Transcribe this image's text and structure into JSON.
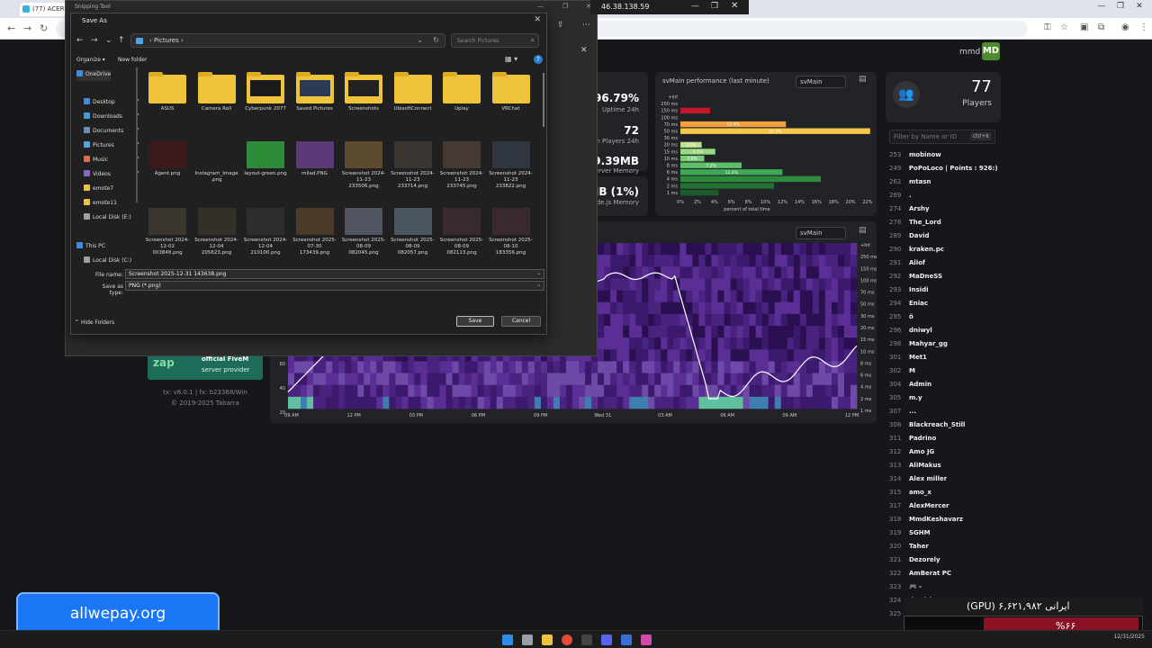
{
  "browser": {
    "tab_title": "(77) ACER?",
    "window_controls": [
      "—",
      "❐",
      "✕"
    ],
    "nav": [
      "←",
      "→",
      "↻"
    ]
  },
  "txadmin": {
    "user": "mmd",
    "avatar": "MD",
    "players": {
      "count": "77",
      "label": "Players"
    },
    "filter_placeholder": "Filter by Name or ID",
    "filter_kbd": "ctrl+k",
    "stats_right": [
      {
        "big": "96.79%",
        "small": "Uptime 24h"
      },
      {
        "big": "72",
        "small": "an Players 24h"
      },
      {
        "big": "929.39MB",
        "small": "erver Memory"
      },
      {
        "big": "1MB (1%)",
        "small": "de.js Memory"
      }
    ],
    "perf": {
      "title": "svMain performance (last minute)",
      "select": "svMain",
      "xlabel": "percent of total time"
    },
    "heat_select": "svMain",
    "sponsor": {
      "logo": "zap",
      "line1": "official FiveM",
      "line2": "server provider"
    },
    "version": [
      "tx: v8.0.1 | fx: b23368/Win",
      "© 2019-2025 Tabarra"
    ],
    "player_list": [
      {
        "id": "253",
        "name": "mobinow"
      },
      {
        "id": "249",
        "name": "PoPoLoco | Points : 926:)"
      },
      {
        "id": "262",
        "name": "mtasn"
      },
      {
        "id": "269",
        "name": "."
      },
      {
        "id": "274",
        "name": "Arshy"
      },
      {
        "id": "278",
        "name": "The_Lord"
      },
      {
        "id": "289",
        "name": "David"
      },
      {
        "id": "290",
        "name": "kraken.pc"
      },
      {
        "id": "291",
        "name": "Aliof"
      },
      {
        "id": "292",
        "name": "MaDneSS"
      },
      {
        "id": "293",
        "name": "Insidi"
      },
      {
        "id": "294",
        "name": "Eniac"
      },
      {
        "id": "295",
        "name": "ö"
      },
      {
        "id": "296",
        "name": "dniwyl"
      },
      {
        "id": "298",
        "name": "Mahyar_gg"
      },
      {
        "id": "301",
        "name": "Met1"
      },
      {
        "id": "302",
        "name": "M"
      },
      {
        "id": "304",
        "name": "Admin"
      },
      {
        "id": "305",
        "name": "m.y"
      },
      {
        "id": "307",
        "name": "..."
      },
      {
        "id": "308",
        "name": "Blackreach_Still"
      },
      {
        "id": "311",
        "name": "Padrino"
      },
      {
        "id": "312",
        "name": "Amo JG"
      },
      {
        "id": "313",
        "name": "AliMakus"
      },
      {
        "id": "314",
        "name": "Alex miller"
      },
      {
        "id": "315",
        "name": "amo_x"
      },
      {
        "id": "317",
        "name": "AlexMercer"
      },
      {
        "id": "318",
        "name": "MmdKeshavarz"
      },
      {
        "id": "319",
        "name": "SGHM"
      },
      {
        "id": "320",
        "name": "Taher"
      },
      {
        "id": "321",
        "name": "Dezorely"
      },
      {
        "id": "322",
        "name": "AmBerat PC"
      },
      {
        "id": "323",
        "name": "🎮 -"
      },
      {
        "id": "324",
        "name": "Ilyad_krm"
      },
      {
        "id": "325",
        "name": "?"
      }
    ]
  },
  "perf_chart": {
    "type": "bar",
    "categories": [
      "+Inf",
      "250 ms",
      "150 ms",
      "100 ms",
      "70 ms",
      "50 ms",
      "30 ms",
      "20 ms",
      "15 ms",
      "10 ms",
      "8 ms",
      "6 ms",
      "4 ms",
      "2 ms",
      "1 ms"
    ],
    "values": [
      0,
      0,
      3.5,
      0,
      12.4,
      22.3,
      0,
      2.5,
      4.1,
      2.8,
      7.2,
      12.0,
      16.5,
      11.0,
      4.5
    ],
    "data_labels": [
      "",
      "",
      "",
      "",
      "12.4%",
      "22.3%",
      "",
      "2.5%",
      "4.1%",
      "2.8%",
      "7.2%",
      "12.0%",
      "",
      "",
      ""
    ],
    "xticks": [
      "0%",
      "2%",
      "4%",
      "6%",
      "8%",
      "10%",
      "12%",
      "14%",
      "16%",
      "18%",
      "20%",
      "22%"
    ],
    "xlim": [
      0,
      22
    ],
    "xlabel": "percent of total time"
  },
  "heat_chart": {
    "type": "heatmap",
    "x_ticks": [
      "09 AM",
      "12 PM",
      "03 PM",
      "06 PM",
      "09 PM",
      "Wed 31",
      "03 AM",
      "06 AM",
      "09 AM",
      "12 PM"
    ],
    "y_ticks": [
      "+Inf",
      "250 ms",
      "150 ms",
      "100 ms",
      "70 ms",
      "50 ms",
      "30 ms",
      "20 ms",
      "15 ms",
      "10 ms",
      "8 ms",
      "6 ms",
      "4 ms",
      "2 ms",
      "1 ms"
    ],
    "y_left": [
      "60",
      "40",
      "20"
    ]
  },
  "snipping": {
    "title": "Snipping Tool",
    "ip": "46.38.138.59",
    "controls": [
      "—",
      "❐",
      "✕"
    ]
  },
  "save_dialog": {
    "title": "Save As",
    "nav": [
      "←",
      "→",
      "⌄",
      "↑"
    ],
    "path": [
      "Pictures"
    ],
    "search_placeholder": "Search Pictures",
    "organize": "Organize ▾",
    "new_folder": "New folder",
    "sidebar": [
      {
        "label": "OneDrive",
        "color": "#3a8ee6"
      },
      {
        "label": "Desktop",
        "color": "#3a8ee6"
      },
      {
        "label": "Downloads",
        "color": "#3aa0e6"
      },
      {
        "label": "Documents",
        "color": "#6b8fb8"
      },
      {
        "label": "Pictures",
        "color": "#4aa8e8"
      },
      {
        "label": "Music",
        "color": "#e06c48"
      },
      {
        "label": "Videos",
        "color": "#8a62d4"
      },
      {
        "label": "emote7",
        "color": "#f0c33c"
      },
      {
        "label": "emote11",
        "color": "#f0c33c"
      },
      {
        "label": "Local Disk (E:)",
        "color": "#9aa0a8"
      },
      {
        "label": "This PC",
        "color": "#3a8ee6"
      },
      {
        "label": "Local Disk (C:)",
        "color": "#9aa0a8"
      }
    ],
    "files": [
      {
        "label": "ASUS",
        "kind": "folder",
        "thumb": ""
      },
      {
        "label": "Camera Roll",
        "kind": "folder",
        "thumb": ""
      },
      {
        "label": "Cyberpunk 2077",
        "kind": "folder",
        "thumb": "#1a1a1a"
      },
      {
        "label": "Saved Pictures",
        "kind": "folder",
        "thumb": "#2d3a55"
      },
      {
        "label": "Screenshots",
        "kind": "folder",
        "thumb": "#222"
      },
      {
        "label": "UbisoftConnect",
        "kind": "folder",
        "thumb": ""
      },
      {
        "label": "Uplay",
        "kind": "folder",
        "thumb": ""
      },
      {
        "label": "VRChat",
        "kind": "folder",
        "thumb": ""
      },
      {
        "label": "Agent.png",
        "kind": "image",
        "thumb": "#3a1a1a"
      },
      {
        "label": "Instagram_Image .png",
        "kind": "image",
        "thumb": "#202020"
      },
      {
        "label": "layout-green.png",
        "kind": "image",
        "thumb": "#2e8b3a"
      },
      {
        "label": "milad.PNG",
        "kind": "image",
        "thumb": "#5b3a78"
      },
      {
        "label": "Screenshot 2024-11-23 233506.png",
        "kind": "image",
        "thumb": "#5a4a30"
      },
      {
        "label": "Screenshot 2024-11-23 233714.png",
        "kind": "image",
        "thumb": "#3a3530"
      },
      {
        "label": "Screenshot 2024-11-23 233745.png",
        "kind": "image",
        "thumb": "#443a33"
      },
      {
        "label": "Screenshot 2024-11-23 233822.png",
        "kind": "image",
        "thumb": "#2f3640"
      },
      {
        "label": "Screenshot 2024-12-02 003848.png",
        "kind": "image",
        "thumb": "#3b3530"
      },
      {
        "label": "Screenshot 2024-12-04 205623.png",
        "kind": "image",
        "thumb": "#33302a"
      },
      {
        "label": "Screenshot 2024-12-04 210100.png",
        "kind": "image",
        "thumb": "#2d2d30"
      },
      {
        "label": "Screenshot 2025-07-30 173439.png",
        "kind": "image",
        "thumb": "#4a3a2a"
      },
      {
        "label": "Screenshot 2025-08-09 082045.png",
        "kind": "image",
        "thumb": "#505560"
      },
      {
        "label": "Screenshot 2025-08-09 082057.png",
        "kind": "image",
        "thumb": "#4c5562"
      },
      {
        "label": "Screenshot 2025-08-09 082113.png",
        "kind": "image",
        "thumb": "#3a2a30"
      },
      {
        "label": "Screenshot 2025-08-10 183356.png",
        "kind": "image",
        "thumb": "#3a2a30"
      }
    ],
    "file_name_label": "File name:",
    "file_name_value": "Screenshot 2025-12-31 143638.png",
    "save_type_label": "Save as type:",
    "save_type_value": "PNG (*.png)",
    "hide_folders": "Hide Folders",
    "save": "Save",
    "cancel": "Cancel"
  },
  "overlay": {
    "promo": "allwepay.org",
    "gpu_text": "(GPU) ۶,۶۲۱,۹۸۲ ایرانی",
    "gpu_percent": "%۶۶",
    "gpu_fill": 0.66,
    "clock": "12/31/2025"
  },
  "colors": {
    "accent": "#1a76f5",
    "heat_purple": "#3b1a6e",
    "heat_line": "#ffffff",
    "bar_red": "#c0182a",
    "bar_yellow": "#f5c84a",
    "bar_green": "#2d8a3e"
  }
}
